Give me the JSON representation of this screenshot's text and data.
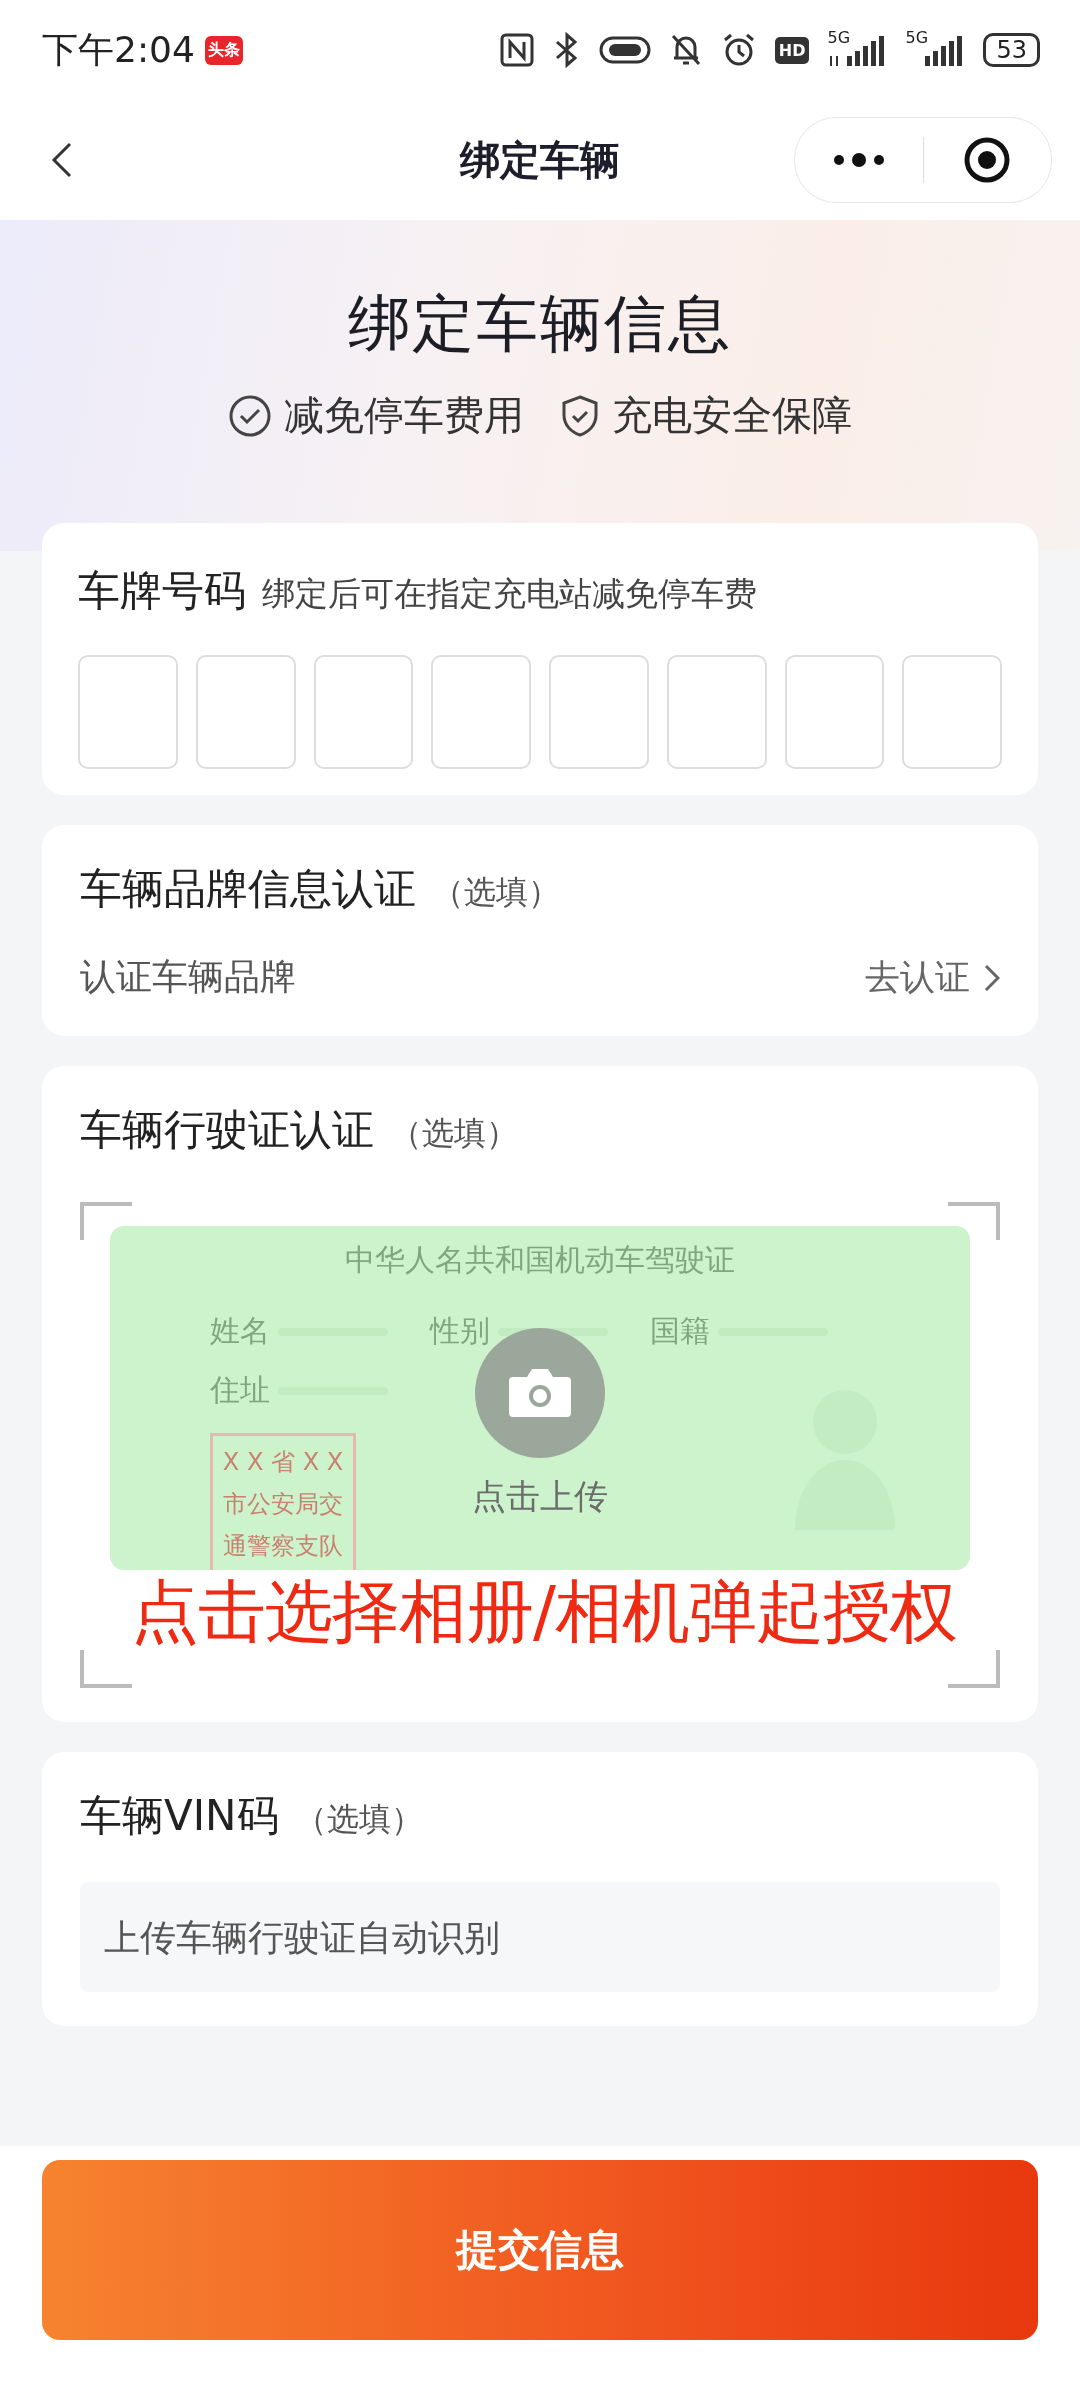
{
  "status_bar": {
    "time": "下午2:04",
    "app_badge": "头条",
    "hd": "HD",
    "sim1": "5G",
    "sim2": "5G",
    "battery": "53"
  },
  "nav": {
    "title": "绑定车辆"
  },
  "header": {
    "title": "绑定车辆信息",
    "features": [
      {
        "kind": "check",
        "label": "减免停车费用"
      },
      {
        "kind": "shield",
        "label": "充电安全保障"
      }
    ]
  },
  "plate": {
    "title": "车牌号码",
    "hint": "绑定后可在指定充电站减免停车费"
  },
  "brand": {
    "title": "车辆品牌信息认证",
    "optional": "（选填）",
    "row_label": "认证车辆品牌",
    "action": "去认证"
  },
  "license": {
    "title": "车辆行驶证认证",
    "optional": "（选填）",
    "sample": {
      "heading": "中华人名共和国机动车驾驶证",
      "fields": [
        "姓名",
        "性别",
        "国籍",
        "住址"
      ],
      "stamp": [
        "X X 省 X X",
        "市公安局交",
        "通警察支队"
      ]
    },
    "upload_label": "点击上传",
    "annotation": "点击选择相册/相机弹起授权"
  },
  "vin": {
    "title": "车辆VIN码",
    "optional": "（选填）",
    "placeholder": "上传车辆行驶证自动识别"
  },
  "submit": {
    "label": "提交信息"
  }
}
